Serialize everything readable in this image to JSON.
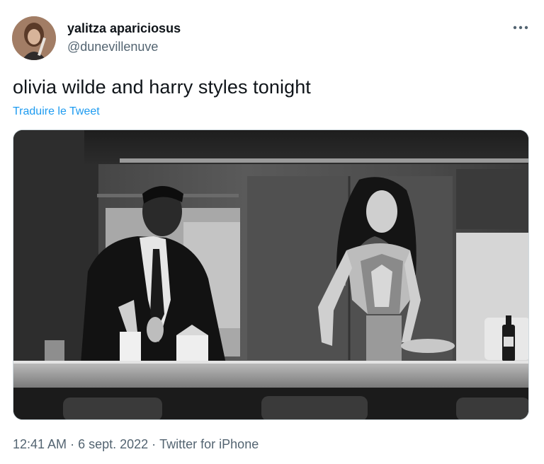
{
  "author": {
    "display_name": "yalitza apariciosus",
    "handle": "@dunevillenuve",
    "avatar_icon": "profile-avatar"
  },
  "menu": {
    "icon": "more-horizontal-icon"
  },
  "tweet": {
    "text": "olivia wilde and harry styles tonight",
    "translate_label": "Traduire le Tweet"
  },
  "media": {
    "description_icon": "photo-image",
    "style": "black-and-white"
  },
  "meta": {
    "time": "12:41 AM",
    "separator": "·",
    "date": "6 sept. 2022",
    "source": "Twitter for iPhone"
  },
  "colors": {
    "text_primary": "#0f1419",
    "text_secondary": "#536471",
    "link": "#1d9bf0",
    "border": "#cfd9de"
  }
}
